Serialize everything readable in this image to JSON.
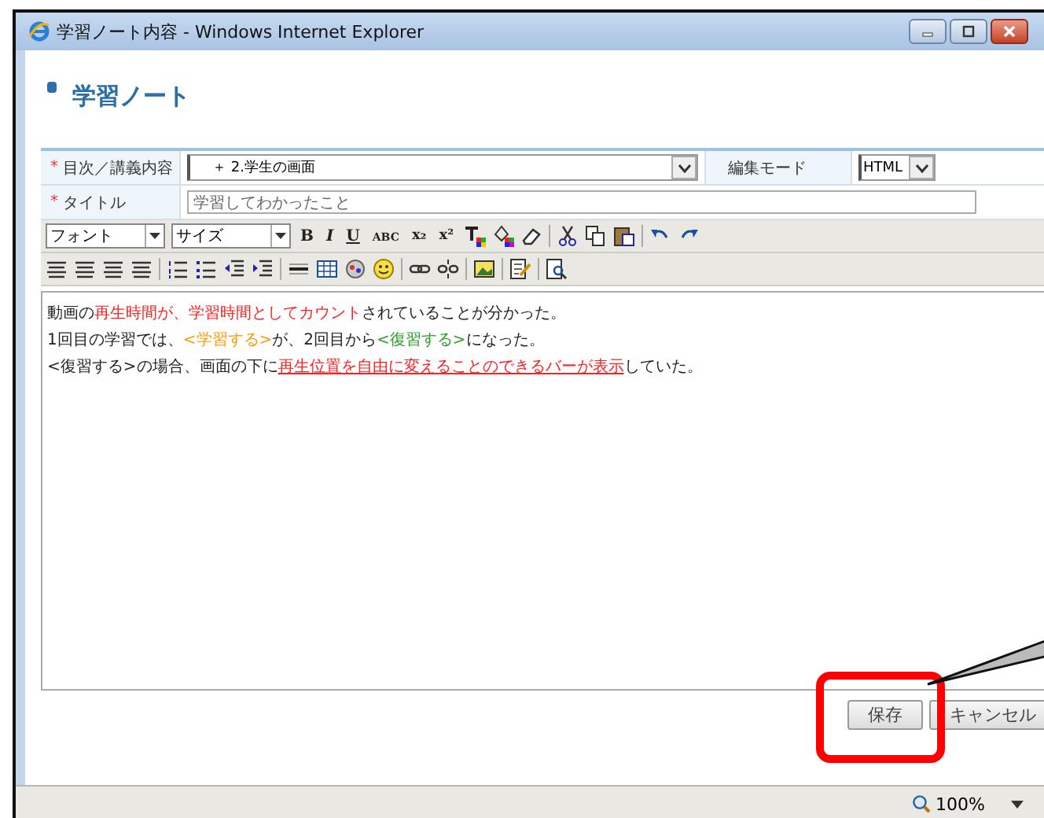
{
  "window": {
    "title": "学習ノート内容 - Windows Internet Explorer"
  },
  "heading": "学習ノート",
  "form": {
    "chapter_label": "目次／講義内容",
    "chapter_value": "＋ 2.学生の画面",
    "mode_label": "編集モード",
    "mode_value": "HTML",
    "title_label": "タイトル",
    "title_value": "学習してわかったこと",
    "required_mark": "*"
  },
  "toolbar": {
    "font": "フォント",
    "size": "サイズ",
    "glyphs": [
      "B",
      "I",
      "U",
      "ABC",
      "x₂",
      "x²"
    ]
  },
  "editor": {
    "lines": [
      [
        {
          "text": "動画の"
        },
        {
          "text": "再生時間が、学習時間としてカウント",
          "color": "#ff2020"
        },
        {
          "text": "されていることが分かった。"
        }
      ],
      [
        {
          "text": "1回目の学習では、"
        },
        {
          "text": "<学習する>",
          "color": "#ff9900"
        },
        {
          "text": "が、2回目から"
        },
        {
          "text": "<復習する>",
          "color": "#2aa02a"
        },
        {
          "text": "になった。"
        }
      ],
      [
        {
          "text": "<復習する>の場合、画面の下に"
        },
        {
          "text": "再生位置を自由に変えることのできるバーが表示",
          "color": "#ff2020",
          "underline": true
        },
        {
          "text": "していた。"
        }
      ]
    ]
  },
  "buttons": [
    "保存",
    "キャンセル"
  ],
  "status_bar": {
    "zoom": "100%"
  }
}
